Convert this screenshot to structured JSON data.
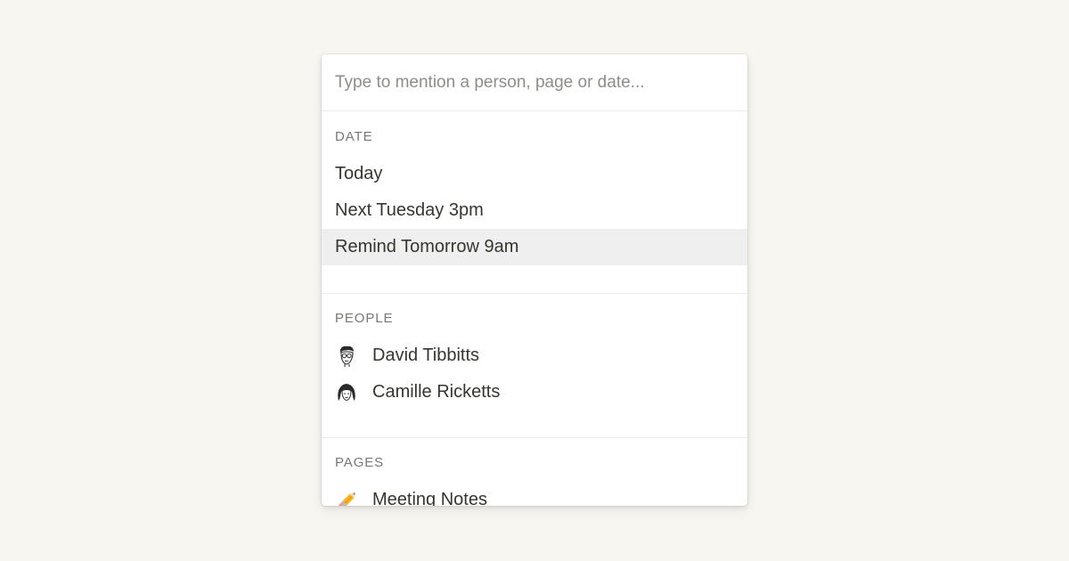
{
  "search": {
    "placeholder": "Type to mention a person, page or date..."
  },
  "sections": {
    "date": {
      "header": "DATE",
      "items": [
        {
          "label": "Today"
        },
        {
          "label": "Next Tuesday 3pm"
        },
        {
          "label": "Remind Tomorrow 9am",
          "selected": true
        }
      ]
    },
    "people": {
      "header": "PEOPLE",
      "items": [
        {
          "label": "David Tibbitts",
          "icon": "avatar-icon"
        },
        {
          "label": "Camille Ricketts",
          "icon": "avatar-icon"
        }
      ]
    },
    "pages": {
      "header": "PAGES",
      "items": [
        {
          "label": "Meeting Notes",
          "icon": "pencil-icon"
        }
      ]
    }
  },
  "colors": {
    "background": "#f8f6f1",
    "text": "#37352f",
    "muted": "#787774",
    "selected_row": "#efefef"
  }
}
